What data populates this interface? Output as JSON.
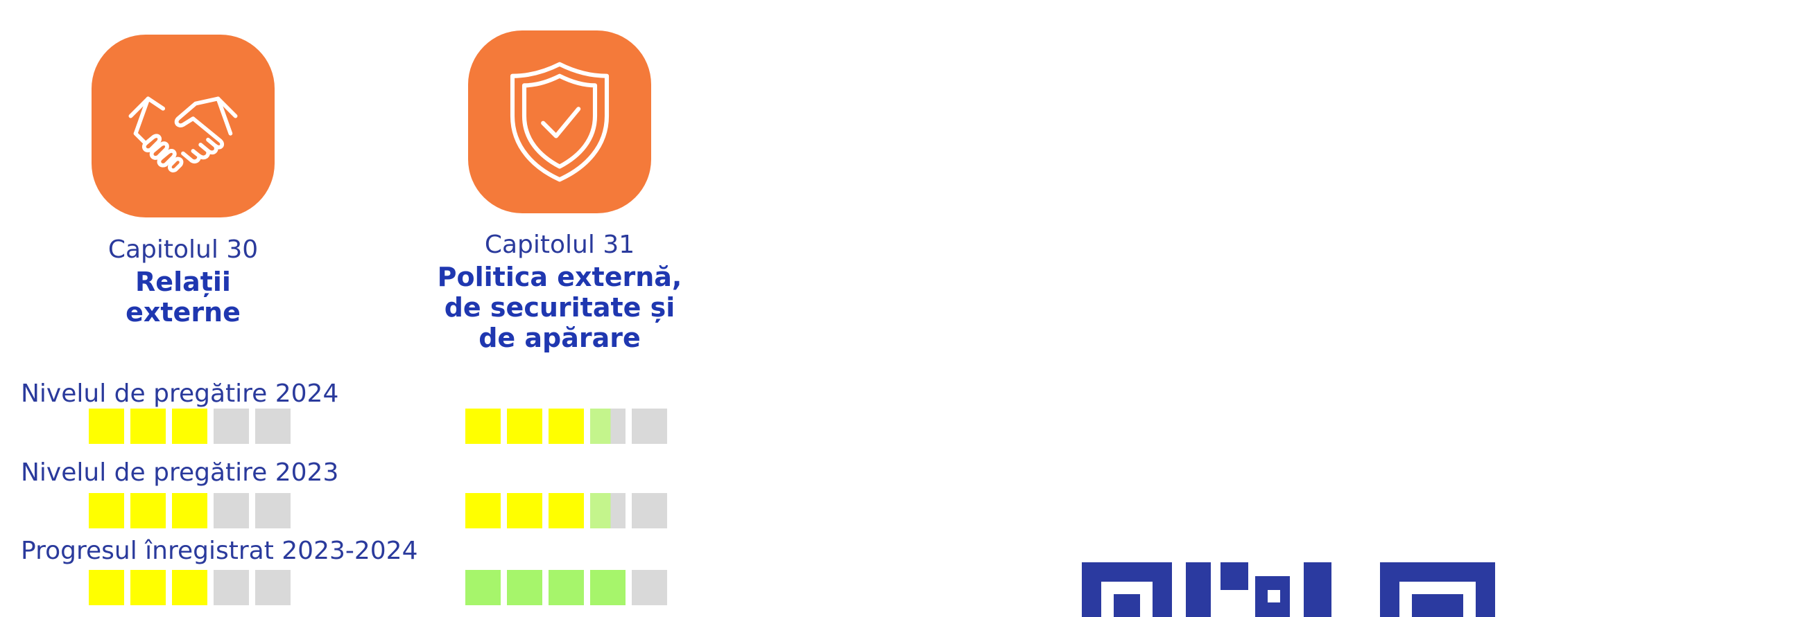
{
  "chapters": [
    {
      "number_label": "Capitolul 30",
      "title_lines": [
        "Relații",
        "externe"
      ],
      "icon": "handshake-icon"
    },
    {
      "number_label": "Capitolul 31",
      "title_lines": [
        "Politica externă,",
        "de securitate și",
        "de apărare"
      ],
      "icon": "shield-check-icon"
    }
  ],
  "levels": [
    {
      "label": "Nivelul de pregătire 2024",
      "chapter30": [
        "y",
        "y",
        "y",
        "empty",
        "empty"
      ],
      "chapter31": [
        "y",
        "y",
        "y",
        "half",
        "empty"
      ]
    },
    {
      "label": "Nivelul de pregătire 2023",
      "chapter30": [
        "y",
        "y",
        "y",
        "empty",
        "empty"
      ],
      "chapter31": [
        "y",
        "y",
        "y",
        "half",
        "empty"
      ]
    },
    {
      "label": "Progresul înregistrat 2023-2024",
      "chapter30": [
        "y",
        "y",
        "y",
        "empty",
        "empty"
      ],
      "chapter31": [
        "g",
        "g",
        "g",
        "g",
        "empty"
      ]
    }
  ],
  "colors": {
    "tile": "#f47a3a",
    "text": "#2a3a9c",
    "yellow": "#ffff00",
    "green": "#a6f56b",
    "grey": "#d9d9d9",
    "qr": "#2b3aa0"
  },
  "qr_icon": "qr-code-icon"
}
